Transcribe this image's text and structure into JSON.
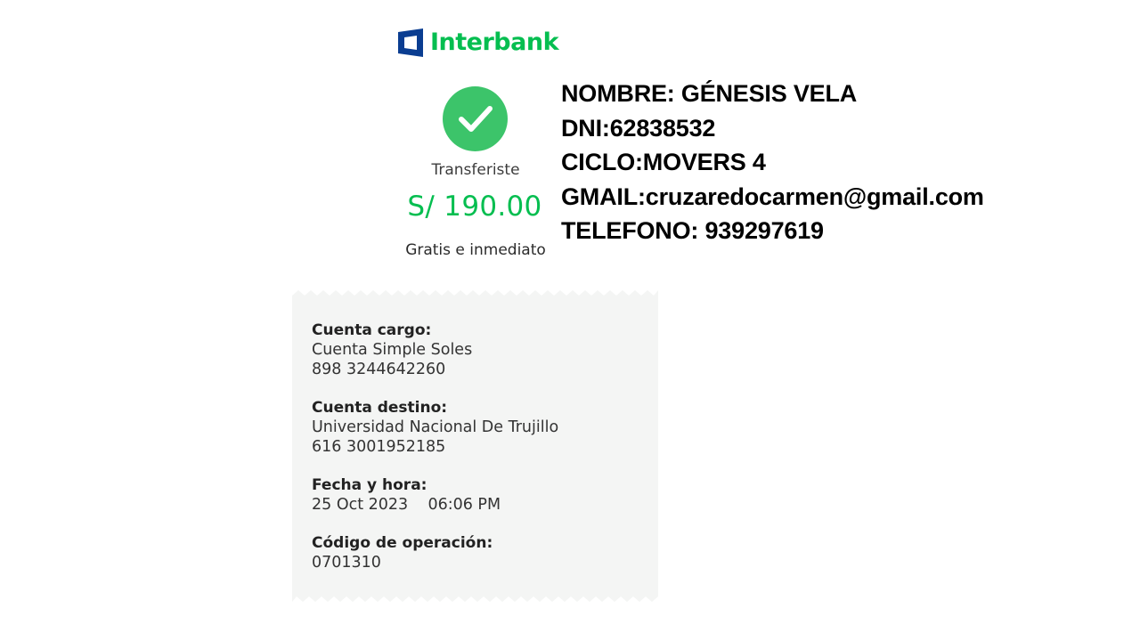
{
  "brand": {
    "name": "Interbank",
    "color": "#05be50",
    "mark_color": "#0a3d91"
  },
  "status": {
    "icon": "check-icon",
    "label": "Transferiste",
    "amount": "S/ 190.00",
    "note": "Gratis e inmediato"
  },
  "student_info": {
    "lines": [
      "NOMBRE: GÉNESIS VELA",
      "DNI:62838532",
      "CICLO:MOVERS 4",
      "GMAIL:cruzaredocarmen@gmail.com",
      "TELEFONO: 939297619"
    ]
  },
  "receipt": {
    "fields": [
      {
        "label": "Cuenta cargo:",
        "values": [
          "Cuenta Simple Soles",
          "898 3244642260"
        ]
      },
      {
        "label": "Cuenta destino:",
        "values": [
          "Universidad Nacional De Trujillo",
          "616 3001952185"
        ]
      },
      {
        "label": "Fecha y hora:",
        "values": [
          "25 Oct 2023    06:06 PM"
        ]
      },
      {
        "label": "Código de operación:",
        "values": [
          "0701310"
        ]
      }
    ]
  }
}
